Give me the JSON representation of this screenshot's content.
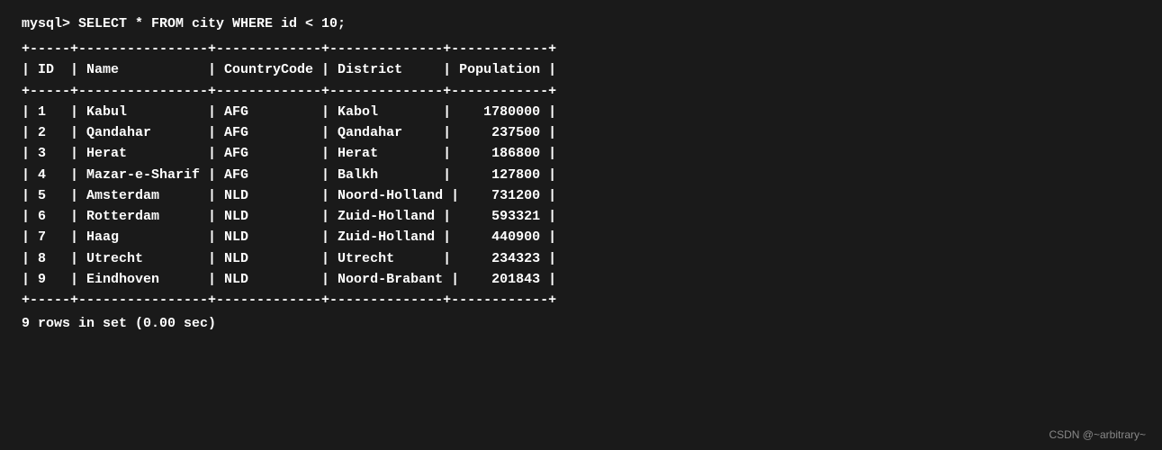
{
  "query": "mysql> SELECT * FROM city WHERE id < 10;",
  "separator": "+-----+----------------+-------------+--------------+-----------+",
  "header": "| ID  | Name           | CountryCode | District     | Population |",
  "rows": [
    "| 1   | Kabul          | AFG         | Kabol        | 1780000   |",
    "| 2   | Qandahar       | AFG         | Qandahar     | 237500    |",
    "| 3   | Herat          | AFG         | Herat        | 186800    |",
    "| 4   | Mazar-e-Sharif | AFG         | Balkh        | 127800    |",
    "| 5   | Amsterdam      | NLD         | Noord-Holland | 731200   |",
    "| 6   | Rotterdam      | NLD         | Zuid-Holland | 593321    |",
    "| 7   | Haag           | NLD         | Zuid-Holland | 440900    |",
    "| 8   | Utrecht        | NLD         | Utrecht      | 234323    |",
    "| 9   | Eindhoven      | NLD         | Noord-Brabant | 201843   |"
  ],
  "footer": "9 rows in set (0.00 sec)",
  "watermark": "CSDN @~arbitrary~"
}
